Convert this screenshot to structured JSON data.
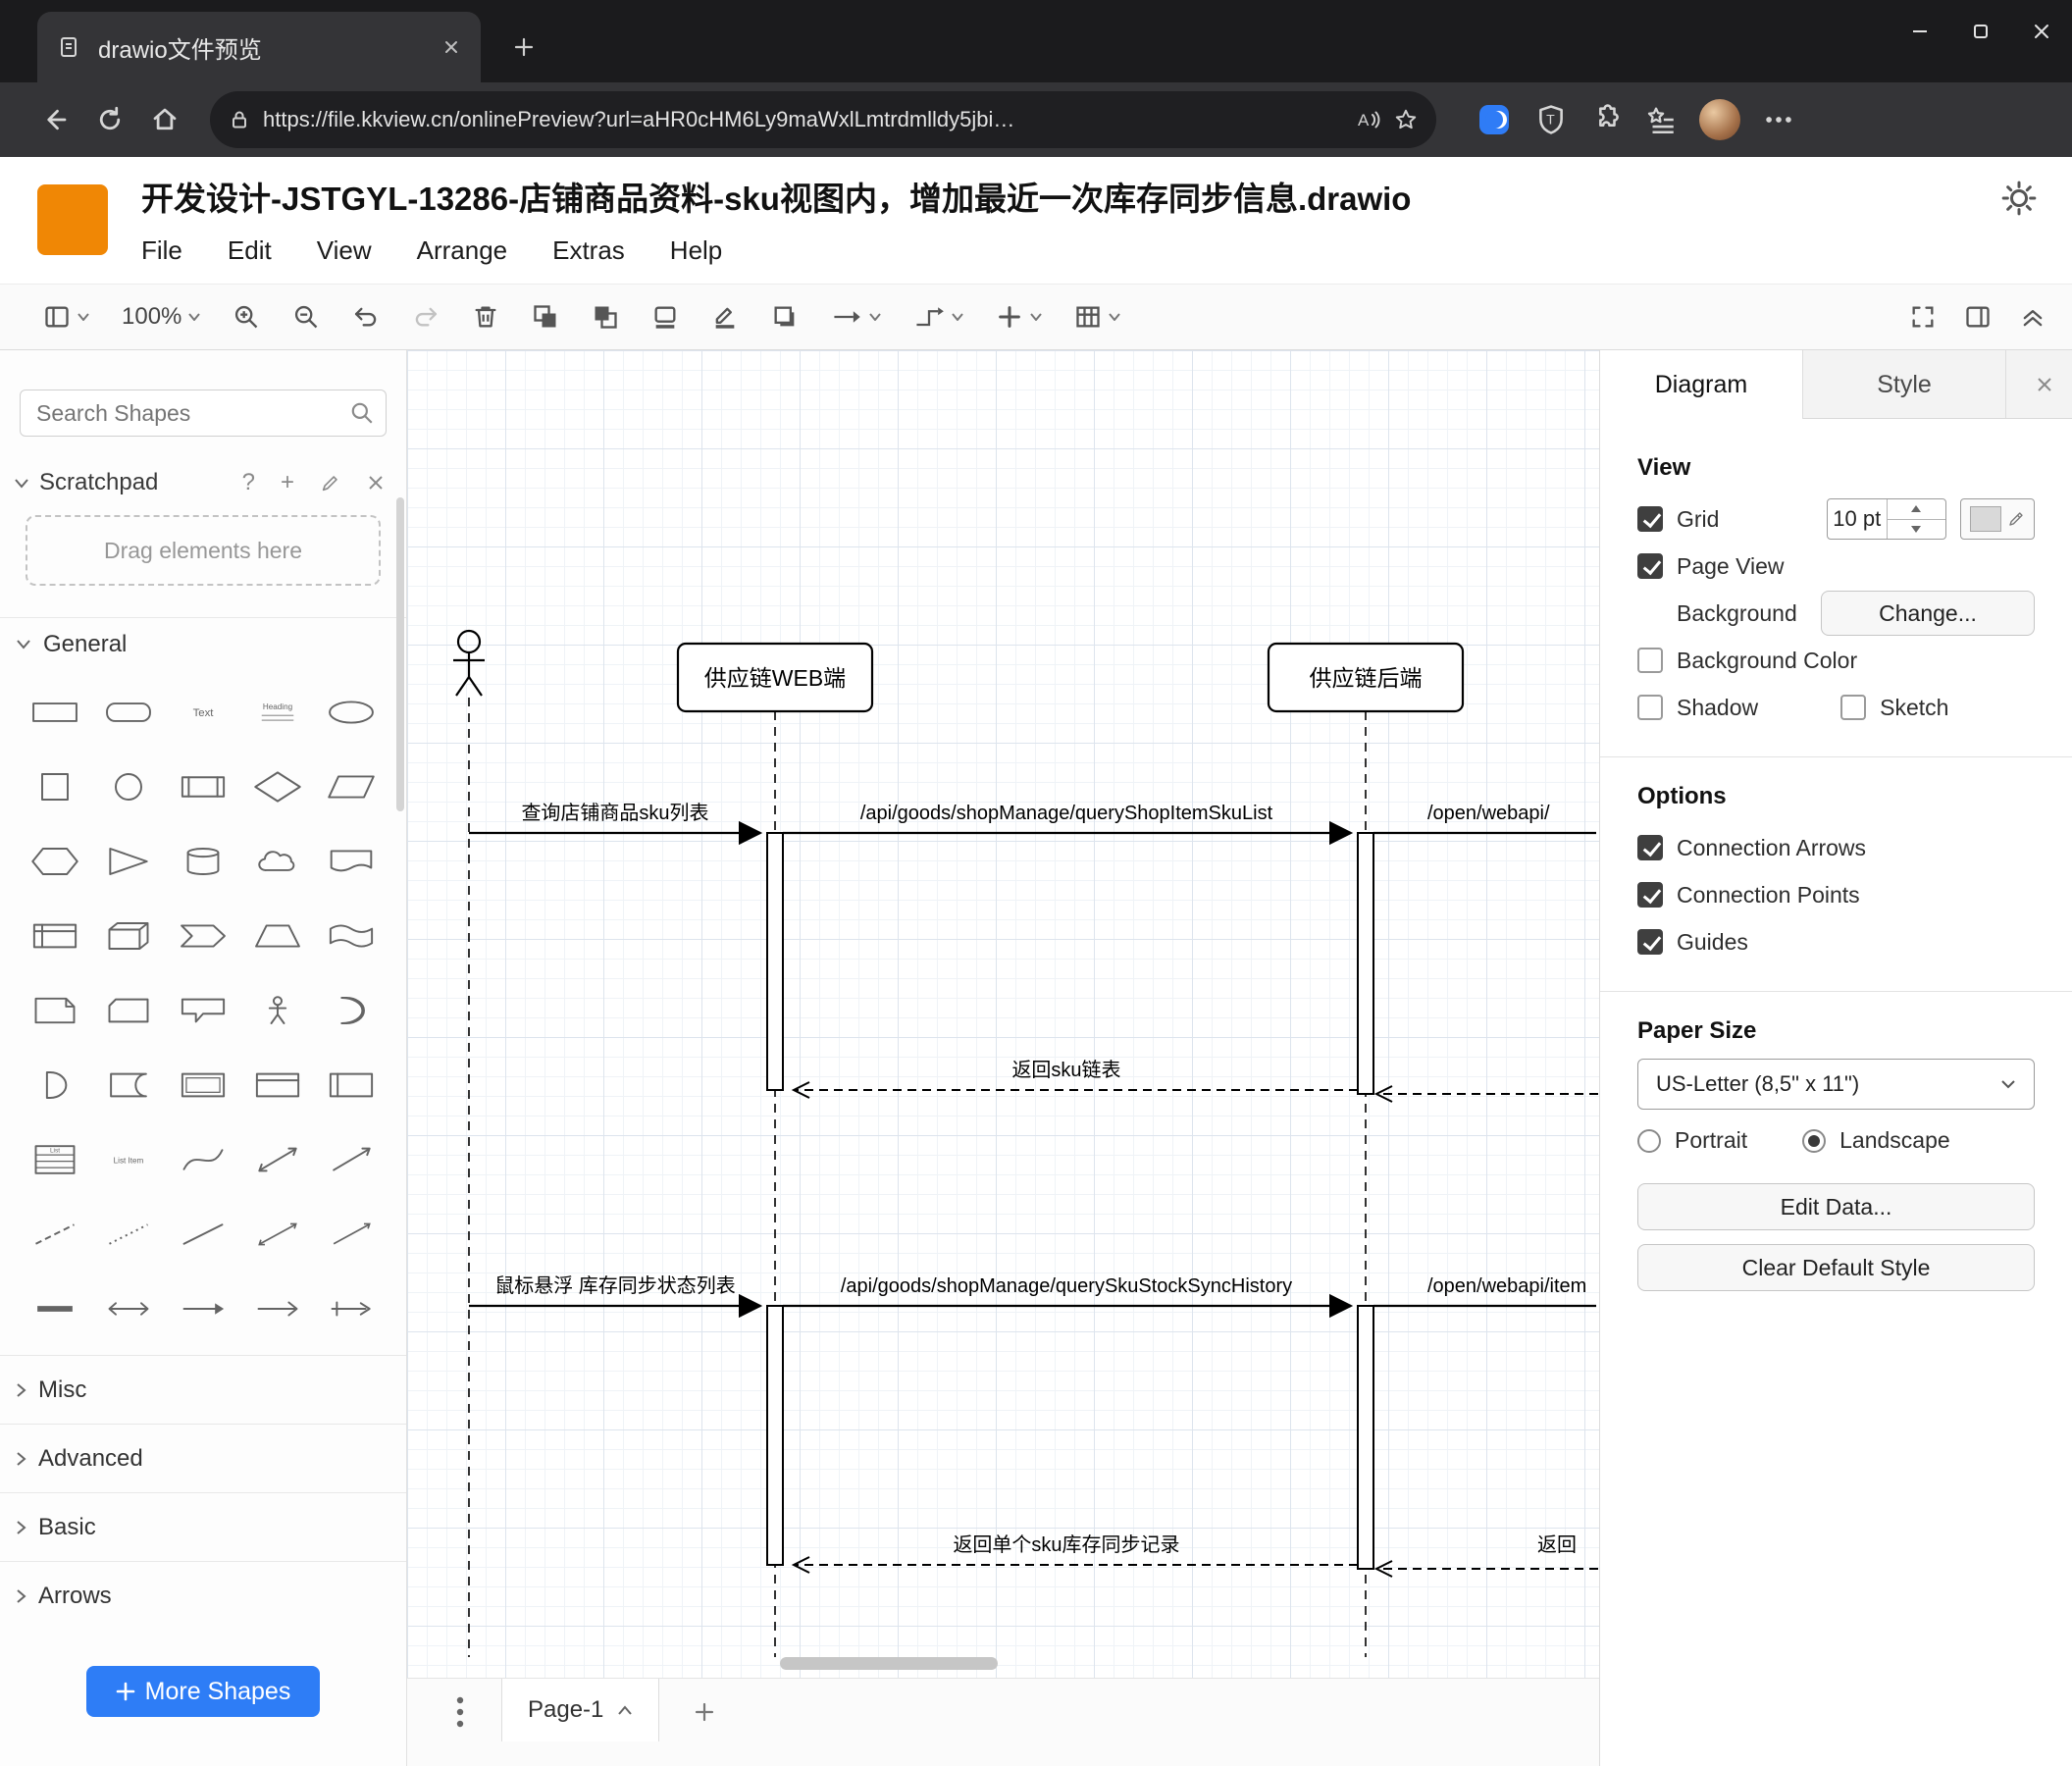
{
  "colors": {
    "brand_orange": "#f08705",
    "accent_blue": "#2e7df6",
    "grid_color_swatch": "#d9d9d9"
  },
  "browser": {
    "tab_title": "drawio文件预览",
    "url": "https://file.kkview.cn/onlinePreview?url=aHR0cHM6Ly9maWxlLmtrdmlldy5jbi…"
  },
  "header": {
    "title": "开发设计-JSTGYL-13286-店铺商品资料-sku视图内，增加最近一次库存同步信息.drawio",
    "menus": [
      "File",
      "Edit",
      "View",
      "Arrange",
      "Extras",
      "Help"
    ]
  },
  "toolbar": {
    "zoom_level": "100%"
  },
  "sidebar": {
    "search_placeholder": "Search Shapes",
    "scratchpad": {
      "title": "Scratchpad",
      "help": "?",
      "drag_hint": "Drag elements here"
    },
    "sections": {
      "general": "General",
      "misc": "Misc",
      "advanced": "Advanced",
      "basic": "Basic",
      "arrows": "Arrows"
    },
    "icon_texts": {
      "text": "Text",
      "heading": "Heading",
      "list": "List",
      "list_item": "List Item"
    },
    "shapes": [
      "rectangle",
      "rounded-rectangle",
      "text",
      "heading",
      "ellipse",
      "square",
      "circle",
      "process",
      "diamond",
      "parallelogram",
      "hexagon",
      "triangle",
      "cylinder",
      "cloud",
      "document",
      "internal-storage",
      "cube",
      "step",
      "trapezoid",
      "tape",
      "note",
      "card",
      "callout",
      "actor",
      "or",
      "and",
      "data-storage",
      "container",
      "horizontal-container",
      "vertical-container",
      "list",
      "list-item",
      "curve",
      "bidirectional-arrow",
      "arrow",
      "dashed-line",
      "dotted-line",
      "line",
      "bidirectional-connector",
      "directional-connector",
      "bold-line",
      "double-arrow",
      "arrow-right",
      "open-arrow",
      "connector-arrow"
    ],
    "more_shapes_label": "More Shapes"
  },
  "diagram": {
    "lifelines": [
      "供应链WEB端",
      "供应链后端"
    ],
    "messages": {
      "query_sku_list": "查询店铺商品sku列表",
      "api_query_shop_item_sku_list": "/api/goods/shopManage/queryShopItemSkuList",
      "open_webapi": "/open/webapi/",
      "return_sku_list": "返回sku链表",
      "hover_stock_sync": "鼠标悬浮 库存同步状态列表",
      "api_query_sku_stock_sync_history": "/api/goods/shopManage/querySkuStockSyncHistory",
      "open_webapi_item": "/open/webapi/item",
      "return_single_sku_sync": "返回单个sku库存同步记录",
      "return_partial": "返回"
    }
  },
  "format_panel": {
    "tabs": [
      "Diagram",
      "Style"
    ],
    "view": {
      "heading": "View",
      "grid": "Grid",
      "grid_size": "10 pt",
      "page_view": "Page View",
      "background": "Background",
      "change_button": "Change...",
      "background_color": "Background Color",
      "shadow": "Shadow",
      "sketch": "Sketch"
    },
    "options": {
      "heading": "Options",
      "connection_arrows": "Connection Arrows",
      "connection_points": "Connection Points",
      "guides": "Guides"
    },
    "paper": {
      "heading": "Paper Size",
      "size_value": "US-Letter (8,5\" x 11\")",
      "portrait": "Portrait",
      "landscape": "Landscape"
    },
    "buttons": {
      "edit_data": "Edit Data...",
      "clear_default_style": "Clear Default Style"
    },
    "states": {
      "grid": true,
      "page_view": true,
      "background_color": false,
      "shadow": false,
      "sketch": false,
      "connection_arrows": true,
      "connection_points": true,
      "guides": true,
      "portrait": false,
      "landscape": true
    }
  },
  "footer": {
    "page_tab": "Page-1"
  }
}
